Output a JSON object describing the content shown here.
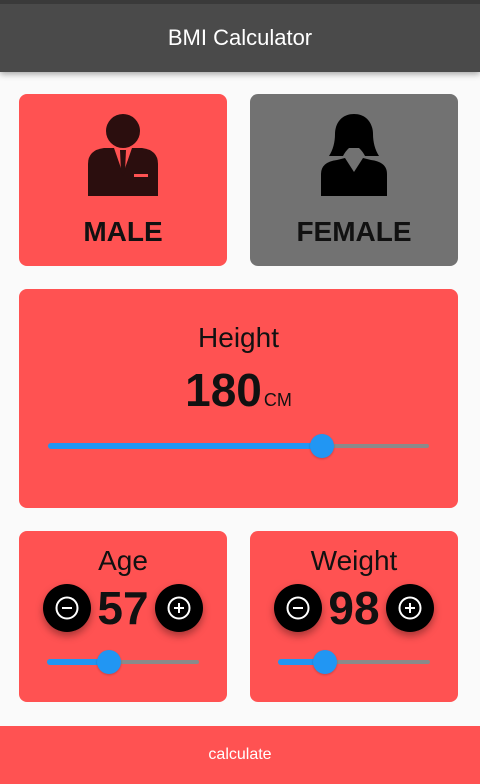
{
  "app_bar": {
    "title": "BMI Calculator"
  },
  "gender": {
    "male": {
      "label": "MALE",
      "icon": "male-icon",
      "selected": true
    },
    "female": {
      "label": "FEMALE",
      "icon": "female-icon",
      "selected": false
    }
  },
  "height": {
    "title": "Height",
    "value": "180",
    "unit": "CM",
    "slider_fraction": 0.72
  },
  "age": {
    "title": "Age",
    "value": "57",
    "slider_fraction": 0.41
  },
  "weight": {
    "title": "Weight",
    "value": "98",
    "slider_fraction": 0.31
  },
  "calculate_button": {
    "label": "calculate"
  },
  "colors": {
    "active_card": "#ff5252",
    "inactive_card": "#727272",
    "accent": "#2196f3",
    "app_bar": "#4a4a4a"
  }
}
